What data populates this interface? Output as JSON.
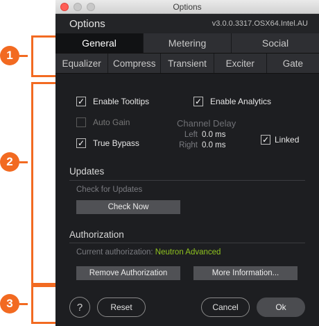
{
  "window": {
    "title": "Options"
  },
  "header": {
    "title": "Options",
    "version": "v3.0.0.3317.OSX64.Intel.AU"
  },
  "tabs_primary": [
    {
      "label": "General",
      "active": true
    },
    {
      "label": "Metering",
      "active": false
    },
    {
      "label": "Social",
      "active": false
    }
  ],
  "tabs_secondary": [
    {
      "label": "Equalizer"
    },
    {
      "label": "Compress"
    },
    {
      "label": "Transient"
    },
    {
      "label": "Exciter"
    },
    {
      "label": "Gate"
    }
  ],
  "general": {
    "enable_tooltips": {
      "label": "Enable Tooltips",
      "checked": true,
      "glyph": "✓"
    },
    "enable_analytics": {
      "label": "Enable Analytics",
      "checked": true,
      "glyph": "✓"
    },
    "auto_gain": {
      "label": "Auto Gain",
      "checked": false,
      "enabled": false
    },
    "true_bypass": {
      "label": "True Bypass",
      "checked": true,
      "glyph": "✓"
    },
    "channel_delay": {
      "title": "Channel Delay",
      "left_label": "Left",
      "left_value": "0.0 ms",
      "right_label": "Right",
      "right_value": "0.0 ms",
      "linked_label": "Linked",
      "linked_checked": true,
      "linked_glyph": "✓"
    }
  },
  "updates": {
    "title": "Updates",
    "check_label": "Check for Updates",
    "button": "Check Now"
  },
  "authorization": {
    "title": "Authorization",
    "current_label": "Current authorization:",
    "current_value": "Neutron Advanced",
    "remove_button": "Remove Authorization",
    "more_button": "More Information..."
  },
  "footer": {
    "help": "?",
    "reset": "Reset",
    "cancel": "Cancel",
    "ok": "Ok"
  },
  "callouts": [
    "1",
    "2",
    "3"
  ],
  "colors": {
    "callout": "#f26a21",
    "accent_green": "#8fc31f",
    "window_bg": "#1d1e21"
  }
}
